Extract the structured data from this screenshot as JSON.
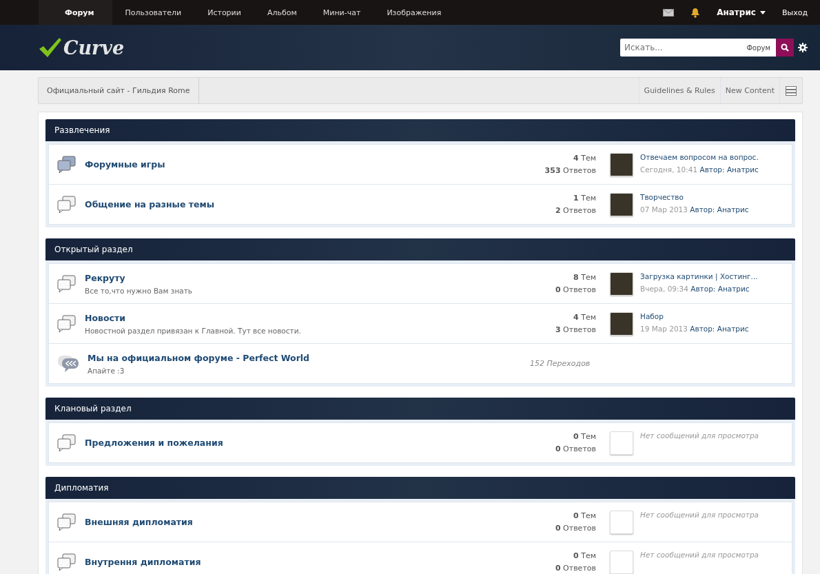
{
  "top_nav": {
    "tabs": [
      {
        "label": "Форум",
        "selected": true
      },
      {
        "label": "Пользователи",
        "selected": false
      },
      {
        "label": "Истории",
        "selected": false
      },
      {
        "label": "Альбом",
        "selected": false
      },
      {
        "label": "Мини-чат",
        "selected": false
      },
      {
        "label": "Изображения",
        "selected": false
      }
    ],
    "user_name": "Анатрис",
    "logout": "Выход"
  },
  "header": {
    "logo": "Curve",
    "search": {
      "placeholder": "Искать...",
      "scope": "Форум"
    }
  },
  "breadcrumb": {
    "items": [
      "Официальный сайт - Гильдия Rome"
    ],
    "links": [
      "Guidelines & Rules",
      "New Content"
    ]
  },
  "categories": [
    {
      "title": "Развлечения",
      "forums": [
        {
          "kind": "forum",
          "unread": true,
          "name": "Форумные игры",
          "topics": "**4** Тем",
          "replies": "**353** Ответов",
          "last_post": {
            "title": "Отвечаем вопросом на вопрос.",
            "date": "Сегодня, 10:41",
            "author_label": "Автор:",
            "author": "Анатрис"
          }
        },
        {
          "kind": "forum",
          "unread": false,
          "name": "Общение на разные темы",
          "topics": "**1** Тем",
          "replies": "**2** Ответов",
          "last_post": {
            "title": "Творчество",
            "date": "07 Мар 2013",
            "author_label": "Автор:",
            "author": "Анатрис"
          }
        }
      ]
    },
    {
      "title": "Открытый раздел",
      "forums": [
        {
          "kind": "forum",
          "unread": false,
          "name": "Рекруту",
          "description": "Все то,что нужно Вам знать",
          "topics": "**8** Тем",
          "replies": "**0** Ответов",
          "last_post": {
            "title": "Загрузка картинки | Хостинг...",
            "date": "Вчера, 09:34",
            "author_label": "Автор:",
            "author": "Анатрис"
          }
        },
        {
          "kind": "forum",
          "unread": false,
          "name": "Новости",
          "description": "Новостной раздел привязан к Главной. Тут все новости.",
          "topics": "**4** Тем",
          "replies": "**3** Ответов",
          "last_post": {
            "title": "Набор",
            "date": "19 Мар 2013",
            "author_label": "Автор:",
            "author": "Анатрис"
          }
        },
        {
          "kind": "redirect",
          "name": "Мы на официальном форуме - Perfect World",
          "description": "Апайте :3",
          "redirects": "152 Переходов"
        }
      ]
    },
    {
      "title": "Клановый раздел",
      "forums": [
        {
          "kind": "forum",
          "unread": false,
          "name": "Предложения и пожелания",
          "topics": "**0** Тем",
          "replies": "**0** Ответов",
          "no_posts": "Нет сообщений для просмотра"
        }
      ]
    },
    {
      "title": "Дипломатия",
      "forums": [
        {
          "kind": "forum",
          "unread": false,
          "name": "Внешняя дипломатия",
          "topics": "**0** Тем",
          "replies": "**0** Ответов",
          "no_posts": "Нет сообщений для просмотра"
        },
        {
          "kind": "forum",
          "unread": false,
          "name": "Внутрення дипломатия",
          "topics": "**0** Тем",
          "replies": "**0** Ответов",
          "no_posts": "Нет сообщений для просмотра"
        }
      ]
    }
  ]
}
